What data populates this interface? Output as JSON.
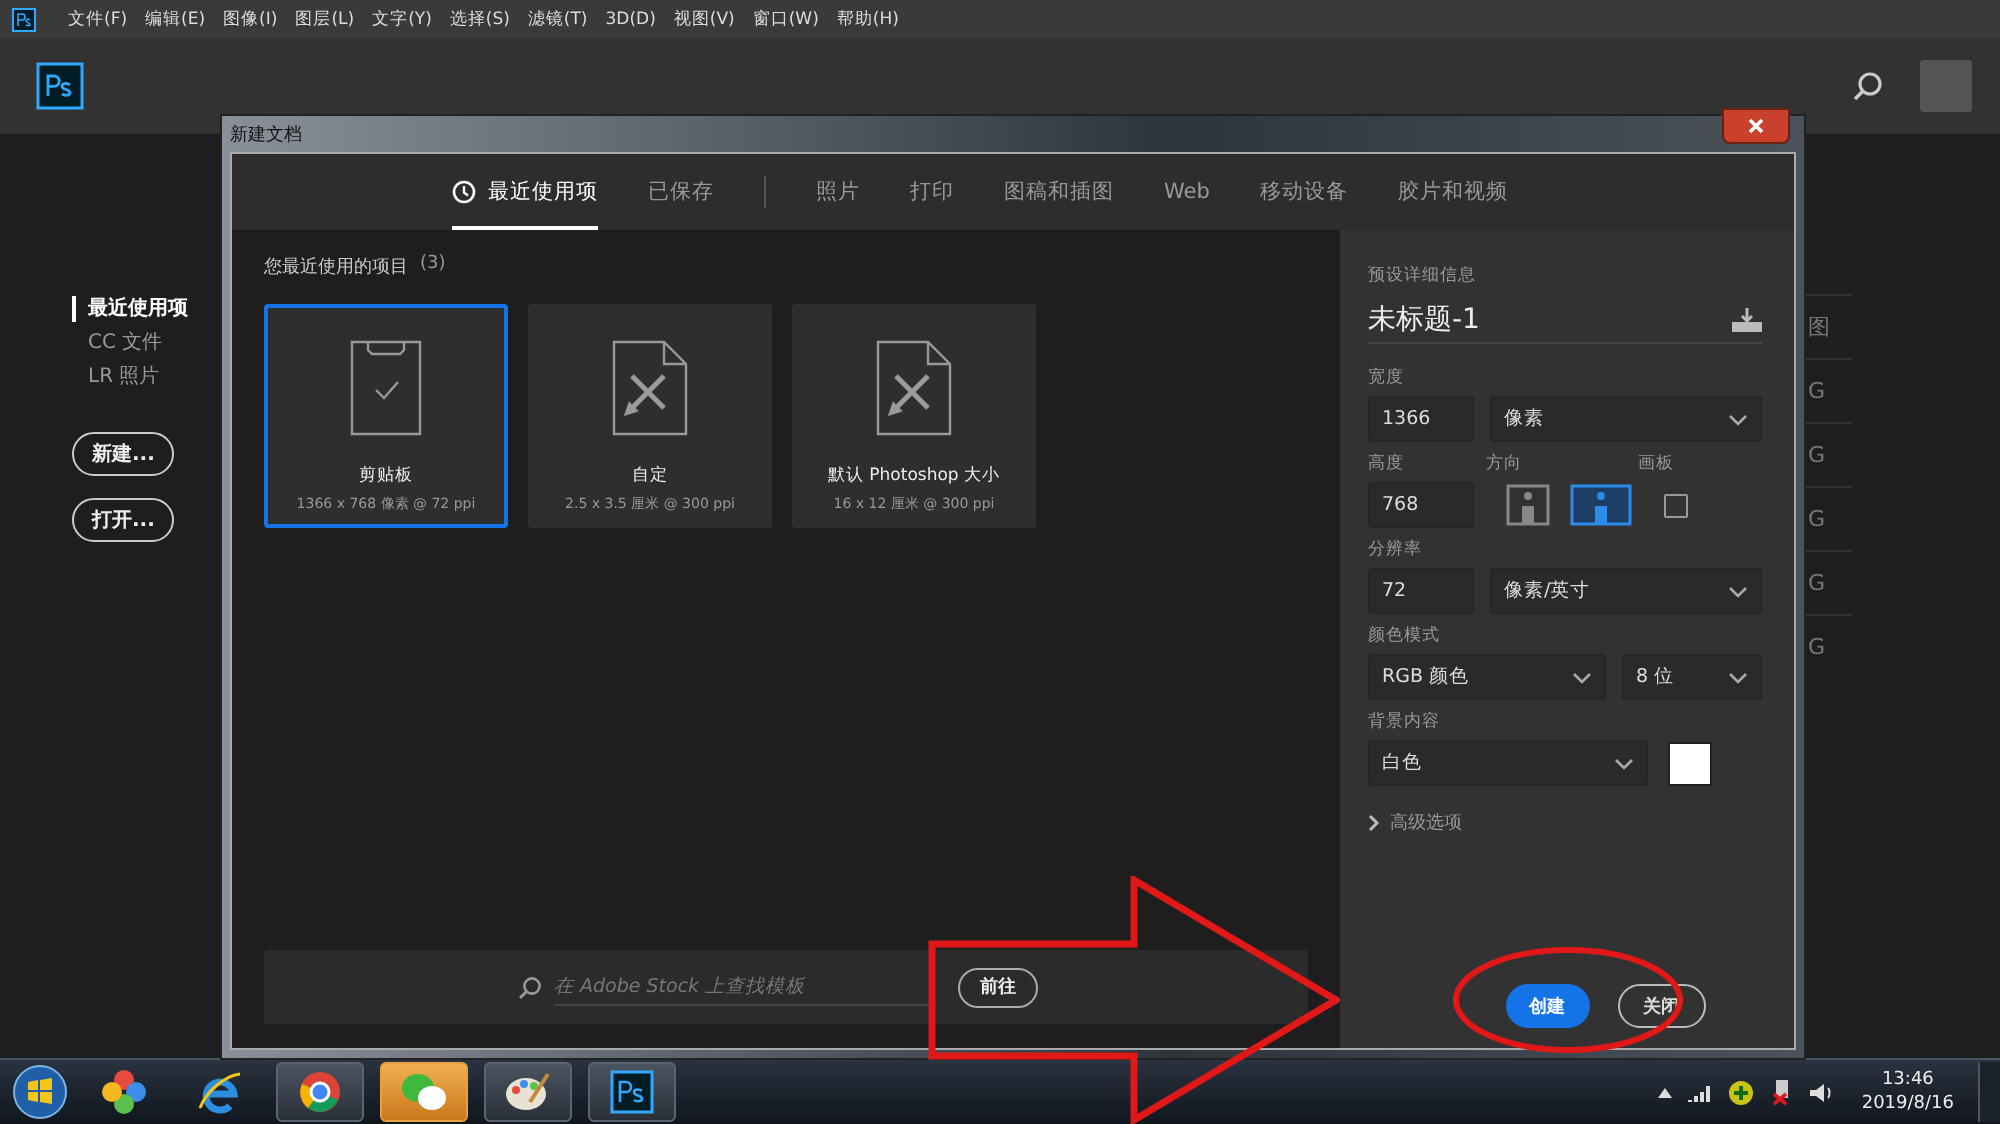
{
  "menu_bar": {
    "items": [
      "文件(F)",
      "编辑(E)",
      "图像(I)",
      "图层(L)",
      "文字(Y)",
      "选择(S)",
      "滤镜(T)",
      "3D(D)",
      "视图(V)",
      "窗口(W)",
      "帮助(H)"
    ]
  },
  "left_nav": {
    "items": [
      {
        "label": "最近使用项",
        "selected": true
      },
      {
        "label": "CC 文件",
        "selected": false
      },
      {
        "label": "LR 照片",
        "selected": false
      }
    ],
    "buttons": [
      "新建...",
      "打开..."
    ]
  },
  "background_list": [
    "图",
    "G",
    "G",
    "G",
    "G",
    "G"
  ],
  "dialog": {
    "title": "新建文档",
    "tabs": [
      {
        "kind": "recent",
        "label": "最近使用项",
        "selected": true
      },
      {
        "kind": "saved",
        "label": "已保存",
        "selected": false
      },
      {
        "kind": "category",
        "label": "照片",
        "selected": false
      },
      {
        "kind": "category",
        "label": "打印",
        "selected": false
      },
      {
        "kind": "category",
        "label": "图稿和插图",
        "selected": false
      },
      {
        "kind": "category",
        "label": "Web",
        "selected": false
      },
      {
        "kind": "category",
        "label": "移动设备",
        "selected": false
      },
      {
        "kind": "category",
        "label": "胶片和视频",
        "selected": false
      }
    ],
    "section_title": "您最近使用的项目",
    "section_count": "(3)",
    "presets": [
      {
        "kind": "clipboard",
        "name": "剪贴板",
        "detail": "1366 x 768 像素 @ 72 ppi",
        "selected": true
      },
      {
        "kind": "document",
        "name": "自定",
        "detail": "2.5 x 3.5 厘米 @ 300 ppi",
        "selected": false
      },
      {
        "kind": "document",
        "name": "默认 Photoshop 大小",
        "detail": "16 x 12 厘米 @ 300 ppi",
        "selected": false
      }
    ],
    "search": {
      "placeholder": "在 Adobe Stock 上查找模板",
      "button": "前往"
    },
    "details": {
      "heading": "预设详细信息",
      "doc_name": "未标题-1",
      "width": {
        "label": "宽度",
        "value": "1366",
        "unit": "像素"
      },
      "height": {
        "label": "高度",
        "value": "768"
      },
      "orientation": {
        "label": "方向",
        "options": [
          {
            "kind": "portrait",
            "selected": false
          },
          {
            "kind": "landscape",
            "selected": true
          }
        ]
      },
      "artboard": {
        "label": "画板",
        "checked": false
      },
      "resolution": {
        "label": "分辨率",
        "value": "72",
        "unit": "像素/英寸"
      },
      "color_mode": {
        "label": "颜色模式",
        "mode": "RGB 颜色",
        "depth": "8 位"
      },
      "background": {
        "label": "背景内容",
        "value": "白色",
        "color": "#ffffff"
      },
      "advanced": "高级选项",
      "buttons": [
        {
          "label": "创建",
          "kind": "primary"
        },
        {
          "label": "关闭",
          "kind": "secondary"
        }
      ]
    }
  },
  "taskbar": {
    "time": "13:46",
    "date": "2019/8/16"
  }
}
